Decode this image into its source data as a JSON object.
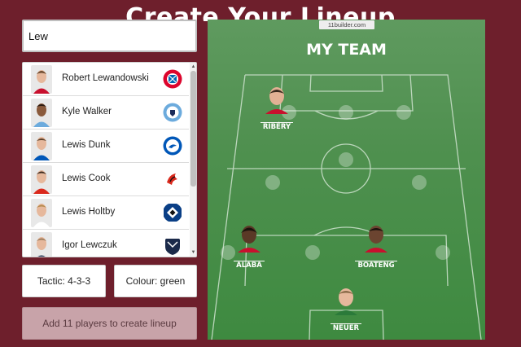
{
  "header": {
    "title": "Create Your Lineup"
  },
  "search": {
    "value": "Lew"
  },
  "results": [
    {
      "name": "Robert Lewandowski",
      "club_icon": "bayern-munich-badge-icon",
      "club_color": "#dc052d"
    },
    {
      "name": "Kyle Walker",
      "club_icon": "manchester-city-badge-icon",
      "club_color": "#6cabdd"
    },
    {
      "name": "Lewis Dunk",
      "club_icon": "brighton-badge-icon",
      "club_color": "#0057b8"
    },
    {
      "name": "Lewis Cook",
      "club_icon": "bournemouth-badge-icon",
      "club_color": "#da291c"
    },
    {
      "name": "Lewis Holtby",
      "club_icon": "hamburg-badge-icon",
      "club_color": "#0a3f86"
    },
    {
      "name": "Igor Lewczuk",
      "club_icon": "bordeaux-badge-icon",
      "club_color": "#1b2a4a"
    }
  ],
  "controls": {
    "tactic_label": "Tactic: 4-3-3",
    "colour_label": "Colour: green",
    "create_label": "Add 11 players to create lineup"
  },
  "pitch": {
    "watermark": "11builder.com",
    "title": "MY TEAM",
    "players": [
      {
        "name": "RIBÉRY"
      },
      {
        "name": "ALABA"
      },
      {
        "name": "BOATENG"
      },
      {
        "name": "NEUER"
      }
    ]
  },
  "colors": {
    "background": "#6e1f2c",
    "pitch_green": "#4f904f",
    "create_button": "#c8a3a9"
  }
}
